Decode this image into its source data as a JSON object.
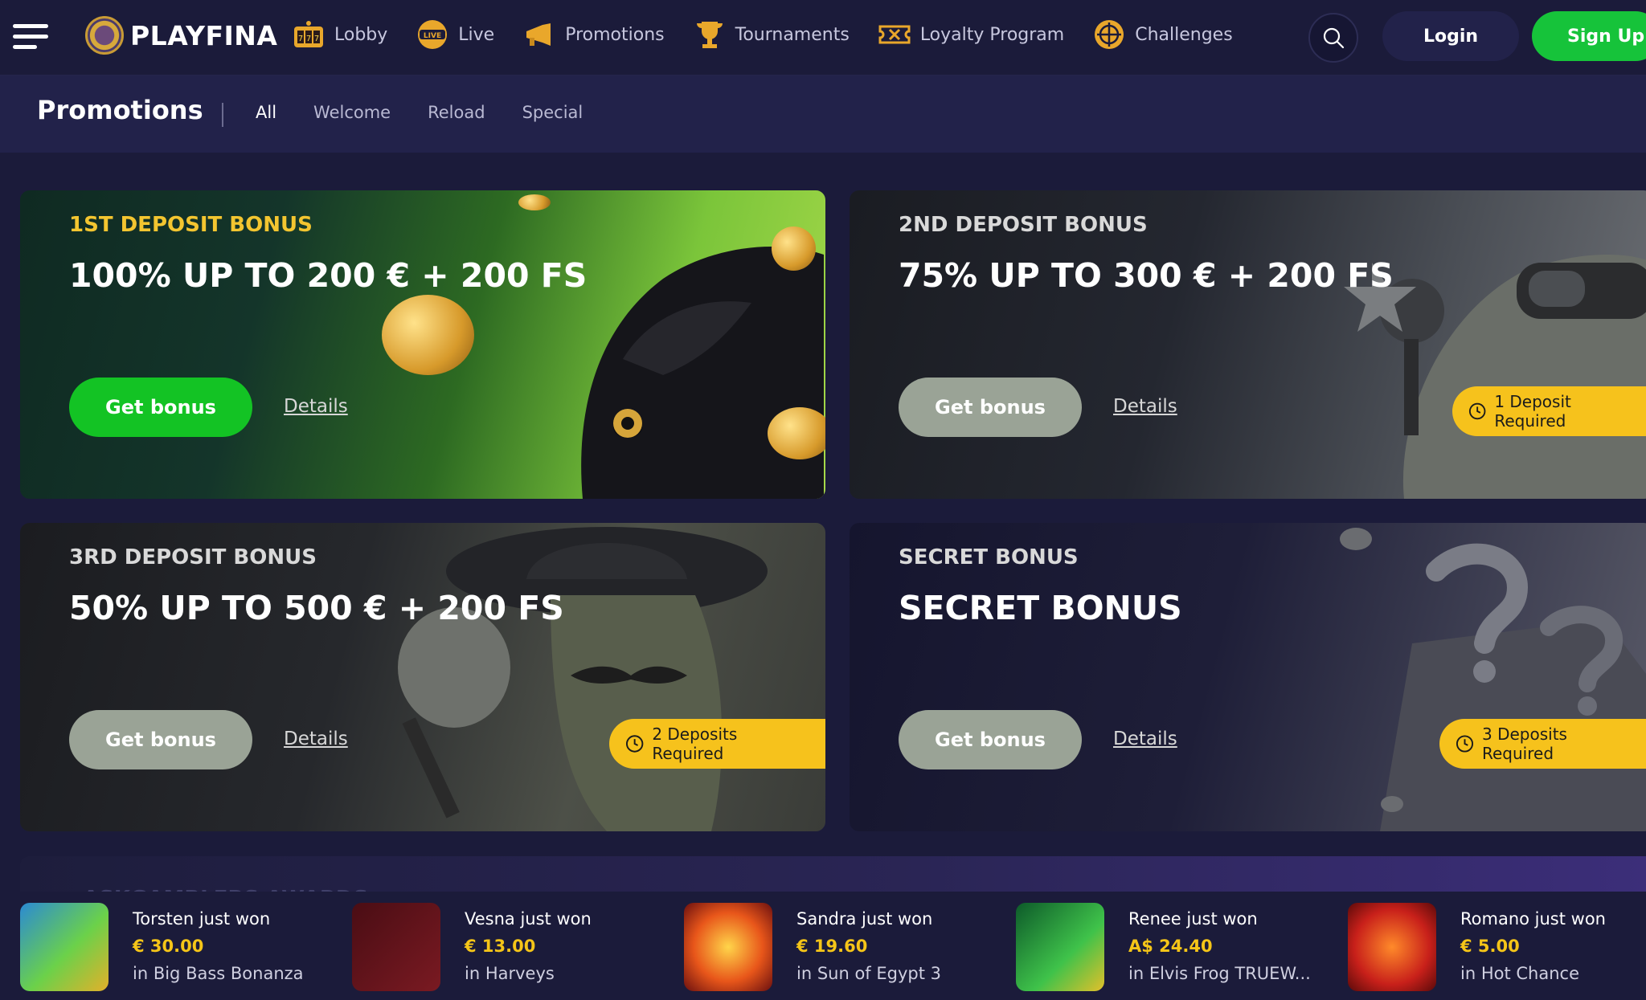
{
  "brand": {
    "name": "PLAYFINA"
  },
  "nav": {
    "items": [
      {
        "label": "Lobby",
        "icon": "slot-777-icon"
      },
      {
        "label": "Live",
        "icon": "live-badge-icon"
      },
      {
        "label": "Promotions",
        "icon": "megaphone-icon"
      },
      {
        "label": "Tournaments",
        "icon": "trophy-icon"
      },
      {
        "label": "Loyalty Program",
        "icon": "ticket-icon"
      },
      {
        "label": "Challenges",
        "icon": "target-icon"
      }
    ],
    "login": "Login",
    "signup": "Sign Up"
  },
  "subheader": {
    "title": "Promotions",
    "tabs": [
      "All",
      "Welcome",
      "Reload",
      "Special"
    ],
    "active_tab": "All"
  },
  "promos": [
    {
      "eyebrow": "1ST DEPOSIT BONUS",
      "title": "100% UP TO 200 € + 200 FS",
      "cta": "Get bonus",
      "details": "Details",
      "requirement": ""
    },
    {
      "eyebrow": "2ND DEPOSIT BONUS",
      "title": "75% UP TO 300 € + 200 FS",
      "cta": "Get bonus",
      "details": "Details",
      "requirement": "1 Deposit Required"
    },
    {
      "eyebrow": "3RD DEPOSIT BONUS",
      "title": "50% UP TO 500 € + 200 FS",
      "cta": "Get bonus",
      "details": "Details",
      "requirement": "2 Deposits Required"
    },
    {
      "eyebrow": "SECRET BONUS",
      "title": "SECRET BONUS",
      "cta": "Get bonus",
      "details": "Details",
      "requirement": "3 Deposits Required"
    }
  ],
  "awards": {
    "label": "ASKGAMBLERS AWARDS"
  },
  "winners": [
    {
      "name": "Torsten just won",
      "amount": "€ 30.00",
      "game": "in Big Bass Bonanza"
    },
    {
      "name": "Vesna just won",
      "amount": "€ 13.00",
      "game": "in Harveys"
    },
    {
      "name": "Sandra just won",
      "amount": "€ 19.60",
      "game": "in Sun of Egypt 3"
    },
    {
      "name": "Renee just won",
      "amount": "A$ 24.40",
      "game": "in Elvis Frog TRUEW..."
    },
    {
      "name": "Romano just won",
      "amount": "€ 5.00",
      "game": "in Hot Chance"
    }
  ],
  "colors": {
    "bg": "#1b1b3a",
    "subbar": "#22224a",
    "accent_green": "#16c33a",
    "accent_yellow": "#f6c21c"
  }
}
